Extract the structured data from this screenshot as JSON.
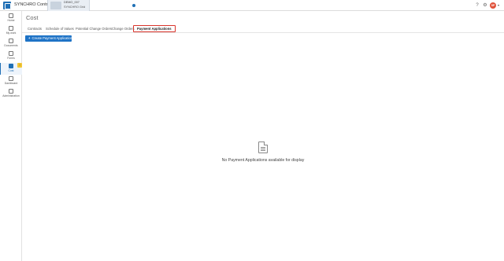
{
  "header": {
    "app_title": "SYNCHRO Control",
    "project": {
      "name": "DEMO_007",
      "subtitle": "SYNCHRO Grid"
    },
    "icons": [
      "help-icon",
      "settings-icon",
      "user-avatar"
    ],
    "avatar_initials": "SP"
  },
  "sidebar": {
    "items": [
      {
        "label": "Home",
        "icon": "home-icon"
      },
      {
        "label": "My work",
        "icon": "inbox-icon"
      },
      {
        "label": "Documents",
        "icon": "document-icon"
      },
      {
        "label": "Forms",
        "icon": "forms-icon"
      },
      {
        "label": "Cost",
        "icon": "cost-icon",
        "active": true,
        "badge": "!"
      },
      {
        "label": "Dashboard",
        "icon": "dashboard-icon"
      },
      {
        "label": "Administration",
        "icon": "admin-icon"
      }
    ]
  },
  "main": {
    "title": "Cost",
    "tabs": [
      {
        "label": "Contracts"
      },
      {
        "label": "Schedule of Values"
      },
      {
        "label": "Potential Change Orders"
      },
      {
        "label": "Change Orders"
      },
      {
        "label": "Payment Applications",
        "active": true
      }
    ],
    "create_button": {
      "icon": "+",
      "label": "Create Payment Application"
    },
    "empty_state": "No Payment Applications available for display"
  },
  "colors": {
    "accent": "#1e73c6",
    "active_tab_border": "#d9342b",
    "badge": "#f3c634",
    "avatar": "#e0533c"
  }
}
